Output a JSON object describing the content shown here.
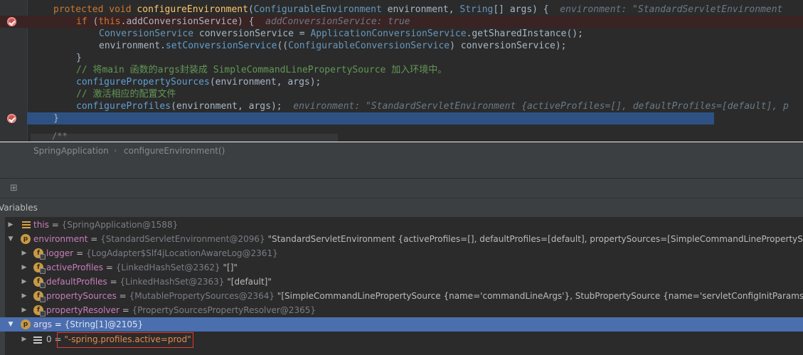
{
  "editor": {
    "lines": [
      {
        "kind": "signature",
        "parts": {
          "kw1": "protected",
          "kw2": "void",
          "fn": "configureEnvironment",
          "p1": "(",
          "t1": "ConfigurableEnvironment",
          "p2": " environment, ",
          "t2": "String",
          "p3": "[] args) {",
          "hint": "environment: \"StandardServletEnvironment"
        }
      },
      {
        "kind": "if",
        "parts": {
          "kw1": "if",
          "p1": " (",
          "kw2": "this",
          "p2": ".addConversionService) {",
          "hint": "addConversionService: true"
        }
      },
      {
        "kind": "decl",
        "parts": {
          "t1": "ConversionService",
          "p1": " conversionService = ",
          "t2": "ApplicationConversionService",
          "p2": ".getSharedInstance();"
        }
      },
      {
        "kind": "call",
        "parts": {
          "p1": "environment.",
          "m1": "setConversionService",
          "p2": "((",
          "t1": "ConfigurableConversionService",
          "p3": ") conversionService);"
        }
      },
      {
        "kind": "brace",
        "parts": {
          "p1": "}"
        }
      },
      {
        "kind": "comment",
        "parts": {
          "c1": "// 将main 函数的args封装成 SimpleCommandLinePropertySource 加入环境中。"
        }
      },
      {
        "kind": "call2",
        "parts": {
          "m1": "configurePropertySources",
          "p1": "(environment, args);"
        }
      },
      {
        "kind": "comment",
        "parts": {
          "c1": "// 激活相应的配置文件"
        }
      },
      {
        "kind": "call3",
        "parts": {
          "m1": "configureProfiles",
          "p1": "(environment, args);",
          "hint": "environment: \"StandardServletEnvironment {activeProfiles=[], defaultProfiles=[default], p"
        }
      },
      {
        "kind": "brace",
        "parts": {
          "p1": "}"
        }
      }
    ],
    "fold_hint": "/**"
  },
  "breadcrumb": {
    "items": [
      "SpringApplication",
      "configureEnvironment()"
    ],
    "separator": "›"
  },
  "debug": {
    "layout_icon": "layout-icon",
    "variables_title": "Variables",
    "variables": [
      {
        "name": "this",
        "type": "{SpringApplication@1588}",
        "value": "",
        "icon": "field-icon",
        "arrow": "▶",
        "indent": 0
      },
      {
        "name": "environment",
        "type": "{StandardServletEnvironment@2096}",
        "value": "\"StandardServletEnvironment {activeProfiles=[], defaultProfiles=[default], propertySources=[SimpleCommandLinePropertySource {nam",
        "icon": "protected-field-icon",
        "arrow": "▼",
        "indent": 0
      },
      {
        "name": "logger",
        "type": "{LogAdapter$Slf4jLocationAwareLog@2361}",
        "value": "",
        "icon": "final-field-icon",
        "arrow": "▶",
        "indent": 1
      },
      {
        "name": "activeProfiles",
        "type": "{LinkedHashSet@2362}",
        "value": "\"[]\"",
        "icon": "final-field-icon",
        "arrow": "▶",
        "indent": 1
      },
      {
        "name": "defaultProfiles",
        "type": "{LinkedHashSet@2363}",
        "value": "\"[default]\"",
        "icon": "final-field-icon",
        "arrow": "▶",
        "indent": 1
      },
      {
        "name": "propertySources",
        "type": "{MutablePropertySources@2364}",
        "value": "\"[SimpleCommandLinePropertySource {name='commandLineArgs'}, StubPropertySource {name='servletConfigInitParams'}, StubPro",
        "icon": "final-field-icon",
        "arrow": "▶",
        "indent": 1
      },
      {
        "name": "propertyResolver",
        "type": "{PropertySourcesPropertyResolver@2365}",
        "value": "",
        "icon": "final-field-icon",
        "arrow": "▶",
        "indent": 1
      },
      {
        "name": "args",
        "type": "{String[1]@2105}",
        "value": "",
        "icon": "protected-field-icon",
        "arrow": "▼",
        "indent": 0
      },
      {
        "name": "0",
        "type": "",
        "value": "\"-spring.profiles.active=prod\"",
        "icon": "array-element-icon",
        "arrow": "▶",
        "indent": 1
      }
    ]
  },
  "colors": {
    "editor_bg": "#2b2b2b",
    "keyword": "#cc7832",
    "method": "#ffc66d",
    "type": "#6897bb",
    "comment": "#808080",
    "selection": "#4b6eaf",
    "breakpoint": "#c75450",
    "highlight_box": "#e53935"
  }
}
